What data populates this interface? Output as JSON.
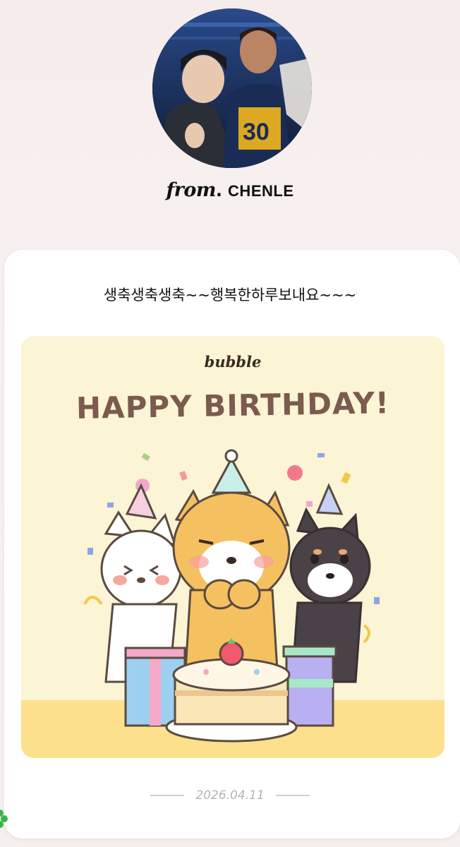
{
  "header": {
    "from_label": "from",
    "sender_name": "CHENLE"
  },
  "letter": {
    "message": "생축생축생축~~행복한하루보내요~~~",
    "card_logo": "bubble",
    "card_title": "HAPPY BIRTHDAY!",
    "date": "2026.04.11"
  },
  "colors": {
    "card_bg": "#fbf4d5",
    "card_band": "#fde08b",
    "title_brown": "#7b5b4d"
  }
}
